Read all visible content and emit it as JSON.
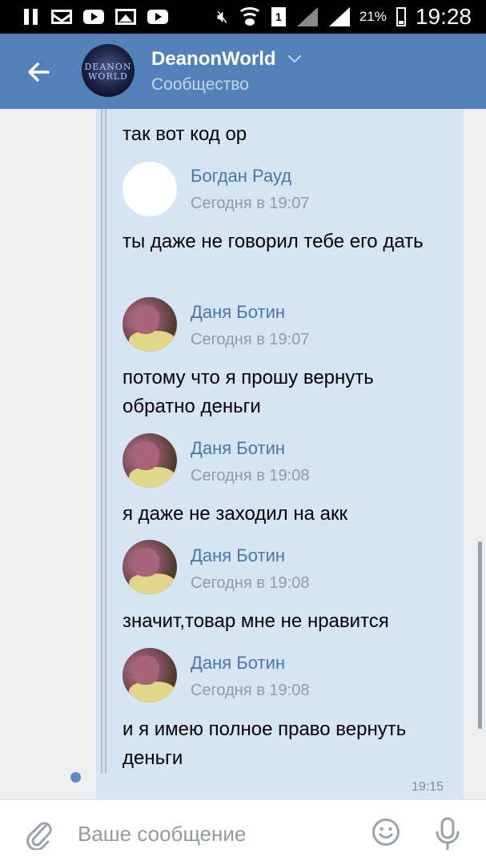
{
  "status_bar": {
    "battery": "21%",
    "time": "19:28",
    "sim_label": "1"
  },
  "header": {
    "title": "DeanonWorld",
    "subtitle": "Сообщество",
    "avatar_lines": [
      "DEANON",
      "WORLD"
    ]
  },
  "messages": [
    {
      "kind": "text",
      "text": "так вот код ор"
    },
    {
      "kind": "author",
      "name": "Богдан Рауд",
      "time": "Сегодня в 19:07",
      "avatar": "blank"
    },
    {
      "kind": "text",
      "text": "ты даже не говорил тебе его дать"
    },
    {
      "kind": "author",
      "name": "Даня Ботин",
      "time": "Сегодня в 19:07",
      "avatar": "photo"
    },
    {
      "kind": "text",
      "text": "потому что я прошу вернуть обратно деньги"
    },
    {
      "kind": "author",
      "name": "Даня Ботин",
      "time": "Сегодня в 19:08",
      "avatar": "photo"
    },
    {
      "kind": "text",
      "text": "я даже не заходил на акк"
    },
    {
      "kind": "author",
      "name": "Даня Ботин",
      "time": "Сегодня в 19:08",
      "avatar": "photo"
    },
    {
      "kind": "text",
      "text": "значит,товар мне не нравится"
    },
    {
      "kind": "author",
      "name": "Даня Ботин",
      "time": "Сегодня в 19:08",
      "avatar": "photo"
    },
    {
      "kind": "text",
      "text": "и я имею полное право вернуть деньги"
    }
  ],
  "message_time": "19:15",
  "input": {
    "placeholder": "Ваше сообщение"
  },
  "colors": {
    "header": "#5181b8",
    "bubble": "#d7e4f4",
    "author_name": "#4a76a8",
    "timestamp": "#939aa2"
  },
  "icons": {
    "back": "arrow-left-icon",
    "attach": "paperclip-icon",
    "emoji": "smile-icon",
    "voice": "microphone-icon"
  }
}
